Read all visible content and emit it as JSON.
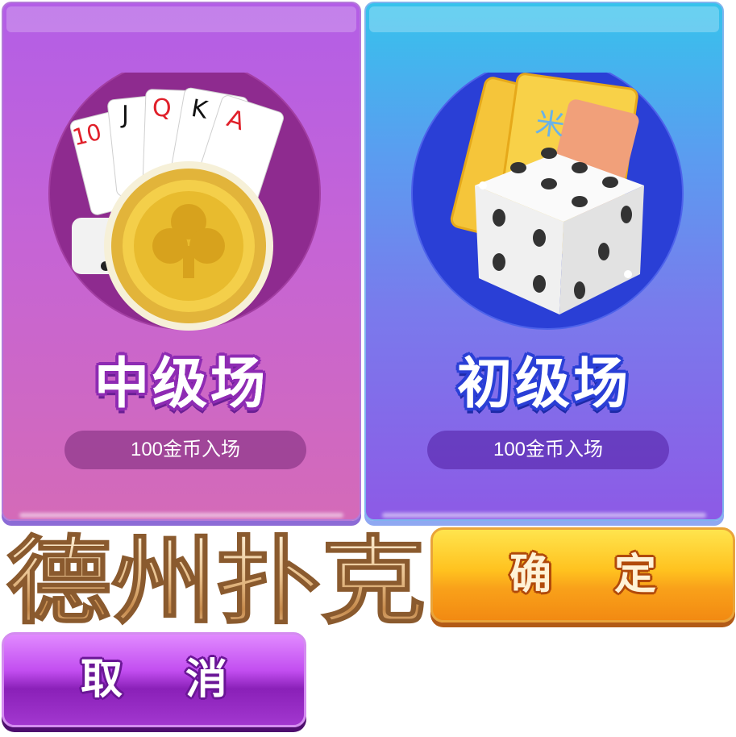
{
  "rooms": [
    {
      "title": "中级场",
      "entry": "100金币入场",
      "art_icon": "playing-cards-and-club-chip-icon",
      "theme": {
        "top": "#b35ee6",
        "bottom": "#d46ab8",
        "circle": "#8e2b8f"
      }
    },
    {
      "title": "初级场",
      "entry": "100金币入场",
      "art_icon": "dice-and-cards-icon",
      "theme": {
        "top": "#36c3ec",
        "bottom": "#8d5ae6",
        "circle": "#2a3fd6"
      }
    }
  ],
  "game_logo": {
    "text": "德州扑克"
  },
  "buttons": {
    "confirm": "确 定",
    "cancel": "取 消"
  }
}
